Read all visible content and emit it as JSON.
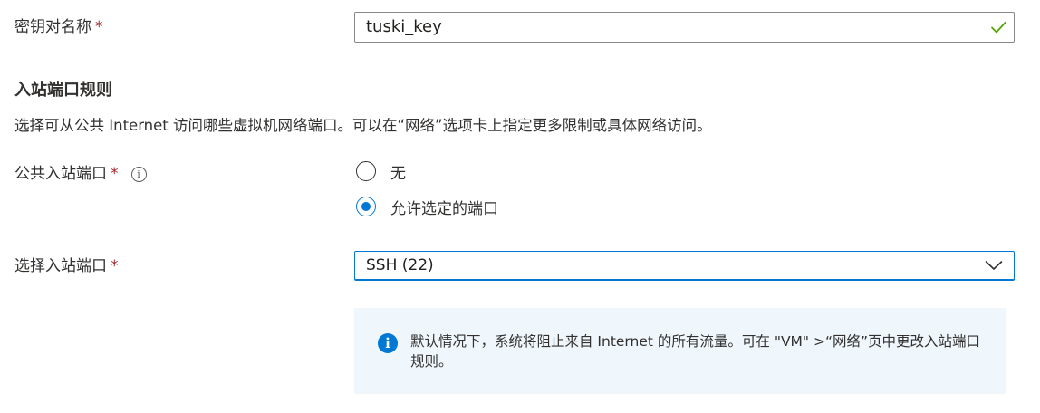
{
  "key_pair": {
    "label": "密钥对名称",
    "required_mark": "*",
    "value": "tuski_key",
    "status_icon": "checkmark-icon",
    "status_color": "#57a300"
  },
  "inbound_rules": {
    "title": "入站端口规则",
    "description": "选择可从公共 Internet 访问哪些虚拟机网络端口。可以在“网络”选项卡上指定更多限制或具体网络访问。"
  },
  "public_ports": {
    "label": "公共入站端口",
    "required_mark": "*",
    "info_icon": "i",
    "options": [
      {
        "label": "无",
        "selected": false
      },
      {
        "label": "允许选定的端口",
        "selected": true
      }
    ]
  },
  "select_ports": {
    "label": "选择入站端口",
    "required_mark": "*",
    "value": "SSH (22)"
  },
  "notice": {
    "icon": "i",
    "text": "默认情况下，系统将阻止来自 Internet 的所有流量。可在 \"VM\" >“网络”页中更改入站端口规则。"
  },
  "colors": {
    "accent": "#0078d4",
    "required": "#a4262c",
    "info_background": "#eff6fc"
  }
}
